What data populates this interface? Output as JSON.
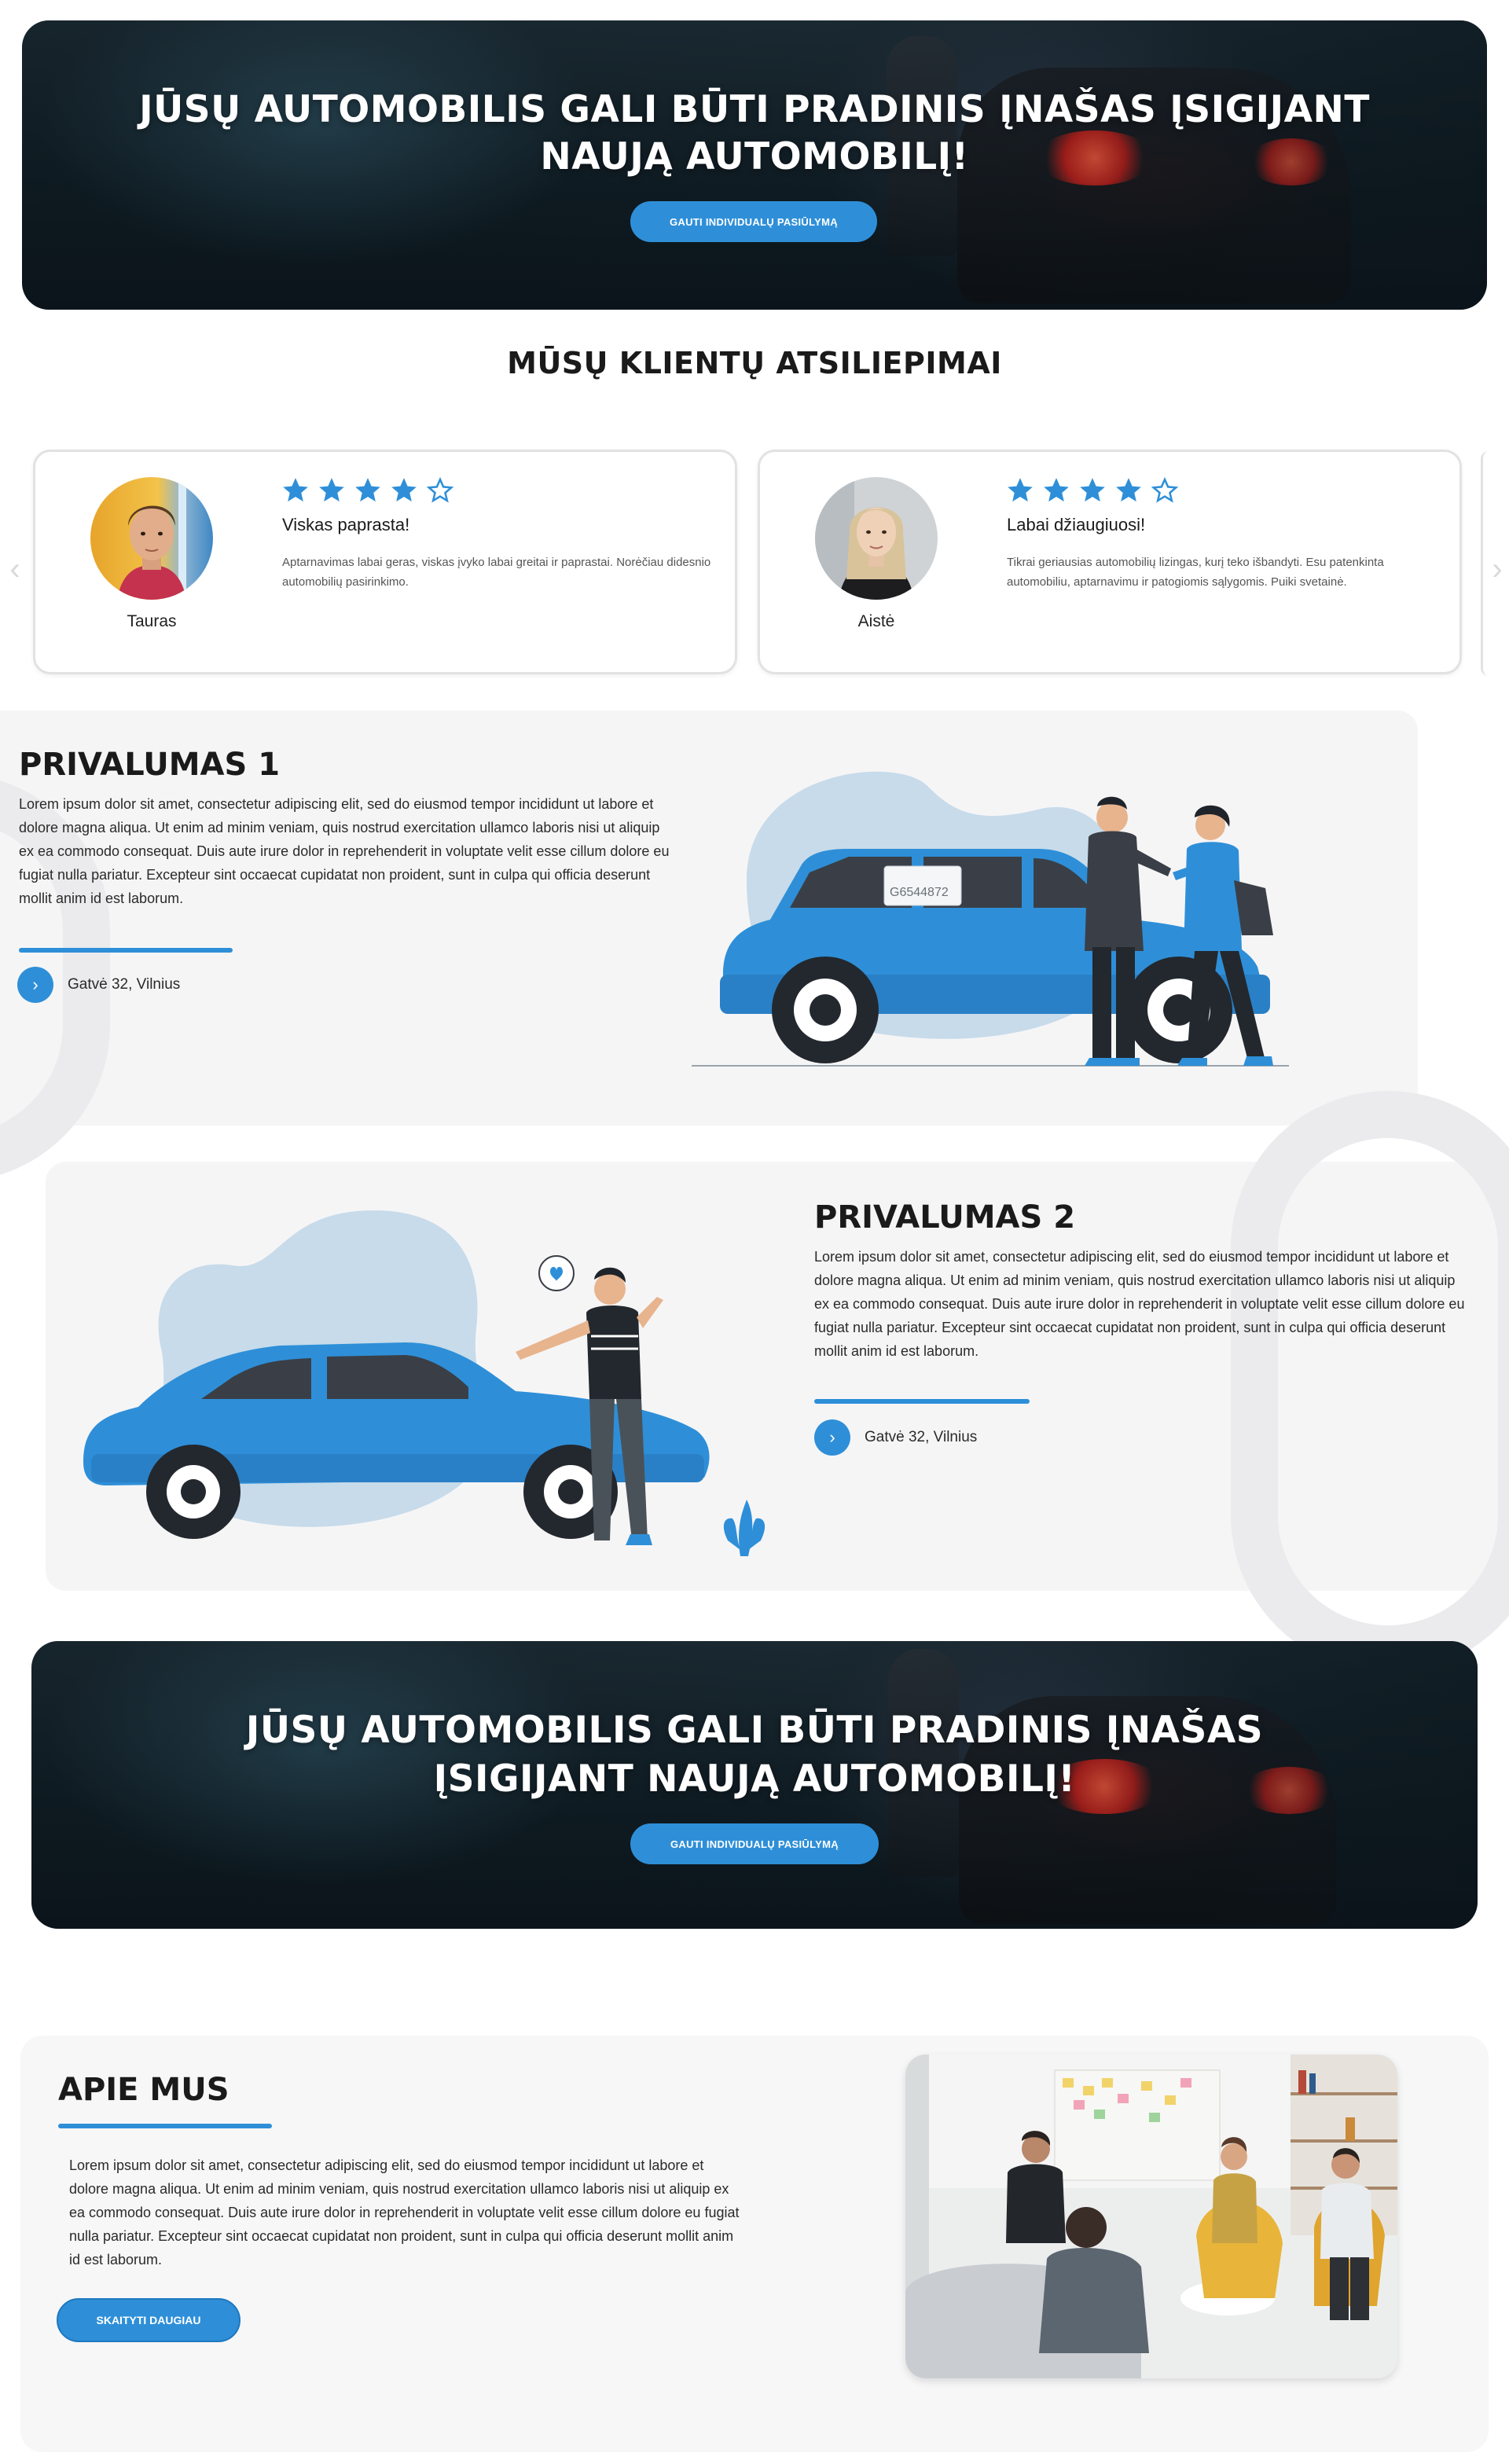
{
  "colors": {
    "accent": "#2e8fd8",
    "card_border": "#e2e2e2",
    "feature_bg": "#f6f5f6",
    "hero_dark": "#0f1b22"
  },
  "hero_top": {
    "title_line1": "JŪSŲ AUTOMOBILIS GALI BŪTI PRADINIS ĮNAŠAS ĮSIGIJANT",
    "title_line2": "NAUJĄ AUTOMOBILĮ!",
    "button_label": "GAUTI INDIVIDUALŲ PASIŪLYMĄ"
  },
  "testimonials": {
    "title": "MŪSŲ KLIENTŲ ATSILIEPIMAI",
    "prev_icon": "chevron-left-icon",
    "next_icon": "chevron-right-icon",
    "reviews": [
      {
        "name": "Tauras",
        "rating": 4,
        "max_rating": 5,
        "title": "Viskas paprasta!",
        "text": "Aptarnavimas labai geras, viskas įvyko labai greitai ir paprastai. Norėčiau didesnio automobilių pasirinkimo."
      },
      {
        "name": "Aistė",
        "rating": 4,
        "max_rating": 5,
        "title": "Labai džiaugiuosi!",
        "text": "Tikrai geriausias automobilių lizingas, kurį teko išbandyti. Esu patenkinta automobiliu, aptarnavimu ir patogiomis sąlygomis. Puiki svetainė."
      }
    ]
  },
  "feature1": {
    "title": "PRIVALUMAS 1",
    "text": "Lorem ipsum dolor sit amet, consectetur adipiscing elit, sed do eiusmod tempor incididunt ut labore et dolore magna aliqua. Ut enim ad minim veniam, quis nostrud exercitation ullamco laboris nisi ut aliquip ex ea commodo consequat. Duis aute irure dolor in reprehenderit in voluptate velit esse cillum dolore eu fugiat nulla pariatur. Excepteur sint occaecat cupidatat non proident, sunt in culpa qui officia deserunt mollit anim id est laborum.",
    "location": "Gatvė 32, Vilnius",
    "plate": "G6544872"
  },
  "feature2": {
    "title": "PRIVALUMAS 2",
    "text": "Lorem ipsum dolor sit amet, consectetur adipiscing elit, sed do eiusmod tempor incididunt ut labore et dolore magna aliqua. Ut enim ad minim veniam, quis nostrud exercitation ullamco laboris nisi ut aliquip ex ea commodo consequat. Duis aute irure dolor in reprehenderit in voluptate velit esse cillum dolore eu fugiat nulla pariatur. Excepteur sint occaecat cupidatat non proident, sunt in culpa qui officia deserunt mollit anim id est laborum.",
    "location": "Gatvė 32, Vilnius"
  },
  "hero_bottom": {
    "title_line1": "JŪSŲ AUTOMOBILIS GALI BŪTI PRADINIS ĮNAŠAS",
    "title_line2": "ĮSIGIJANT NAUJĄ AUTOMOBILĮ!",
    "button_label": "GAUTI INDIVIDUALŲ PASIŪLYMĄ"
  },
  "about": {
    "title": "APIE MUS",
    "text": "Lorem ipsum dolor sit amet, consectetur adipiscing elit, sed do eiusmod tempor incididunt ut labore et dolore magna aliqua. Ut enim ad minim veniam, quis nostrud exercitation ullamco laboris nisi ut aliquip ex ea commodo consequat. Duis aute irure dolor in reprehenderit in voluptate velit esse cillum dolore eu fugiat nulla pariatur. Excepteur sint occaecat cupidatat non proident, sunt in culpa qui officia deserunt mollit anim id est laborum.",
    "button_label": "SKAITYTI DAUGIAU"
  }
}
